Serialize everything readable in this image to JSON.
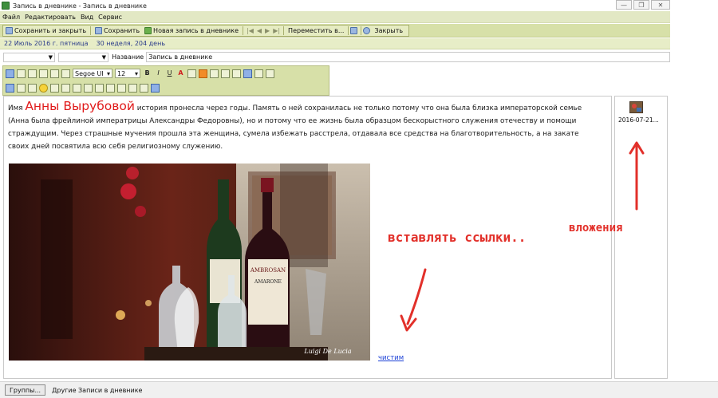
{
  "window": {
    "title": "Запись в дневнике - Запись в дневнике",
    "minimize_glyph": "—",
    "maximize_glyph": "❐",
    "close_glyph": "✕"
  },
  "menu": [
    "Файл",
    "Редактировать",
    "Вид",
    "Сервис"
  ],
  "toolbar": {
    "save_close": "Сохранить и закрыть",
    "save": "Сохранить",
    "new_entry": "Новая запись в дневнике",
    "move": "Переместить в...",
    "close": "Закрыть"
  },
  "date_bar": {
    "date": "22 Июль 2016 г. пятница",
    "week": "30 неделя, 204 день"
  },
  "fields": {
    "name_label": "Название",
    "name_value": "Запись в дневнике"
  },
  "format_bar": {
    "font_name": "Segoe UI",
    "font_size": "12",
    "bold": "B",
    "italic": "I",
    "underline": "U",
    "font_color": "A"
  },
  "editor": {
    "text_before": "Имя ",
    "name": "Анны Вырубовой",
    "text_after": " история пронесла через годы. Память о ней сохранилась не только потому что она была близка императорской семье (Анна была фрейлиной императрицы Александры Федоровны), но и потому что ее жизнь была образцом бескорыстного служения отечеству и помощи страждущим. Через страшные мучения прошла эта женщина, сумела избежать расстрела, отдавала все средства на благотворительность, а на закате своих дней посвятила всю себя религиозному служению.",
    "photo_watermark": "Luigi De Lucia",
    "label_text": "AMBROSAN",
    "label_sub": "AMARONE",
    "link": "чистим"
  },
  "annotations": {
    "links_hint": "вставлять ссылки..",
    "attachments_hint": "вложения"
  },
  "attachments": [
    {
      "name": "2016-07-21..."
    }
  ],
  "status": {
    "groups_button": "Группы...",
    "text": "Другие Записи в дневнике"
  },
  "colors": {
    "toolbar_bg": "#d7e0a8",
    "name_highlight": "#e01a1a",
    "annotation": "#e2302a",
    "link": "#1a3fd6"
  }
}
